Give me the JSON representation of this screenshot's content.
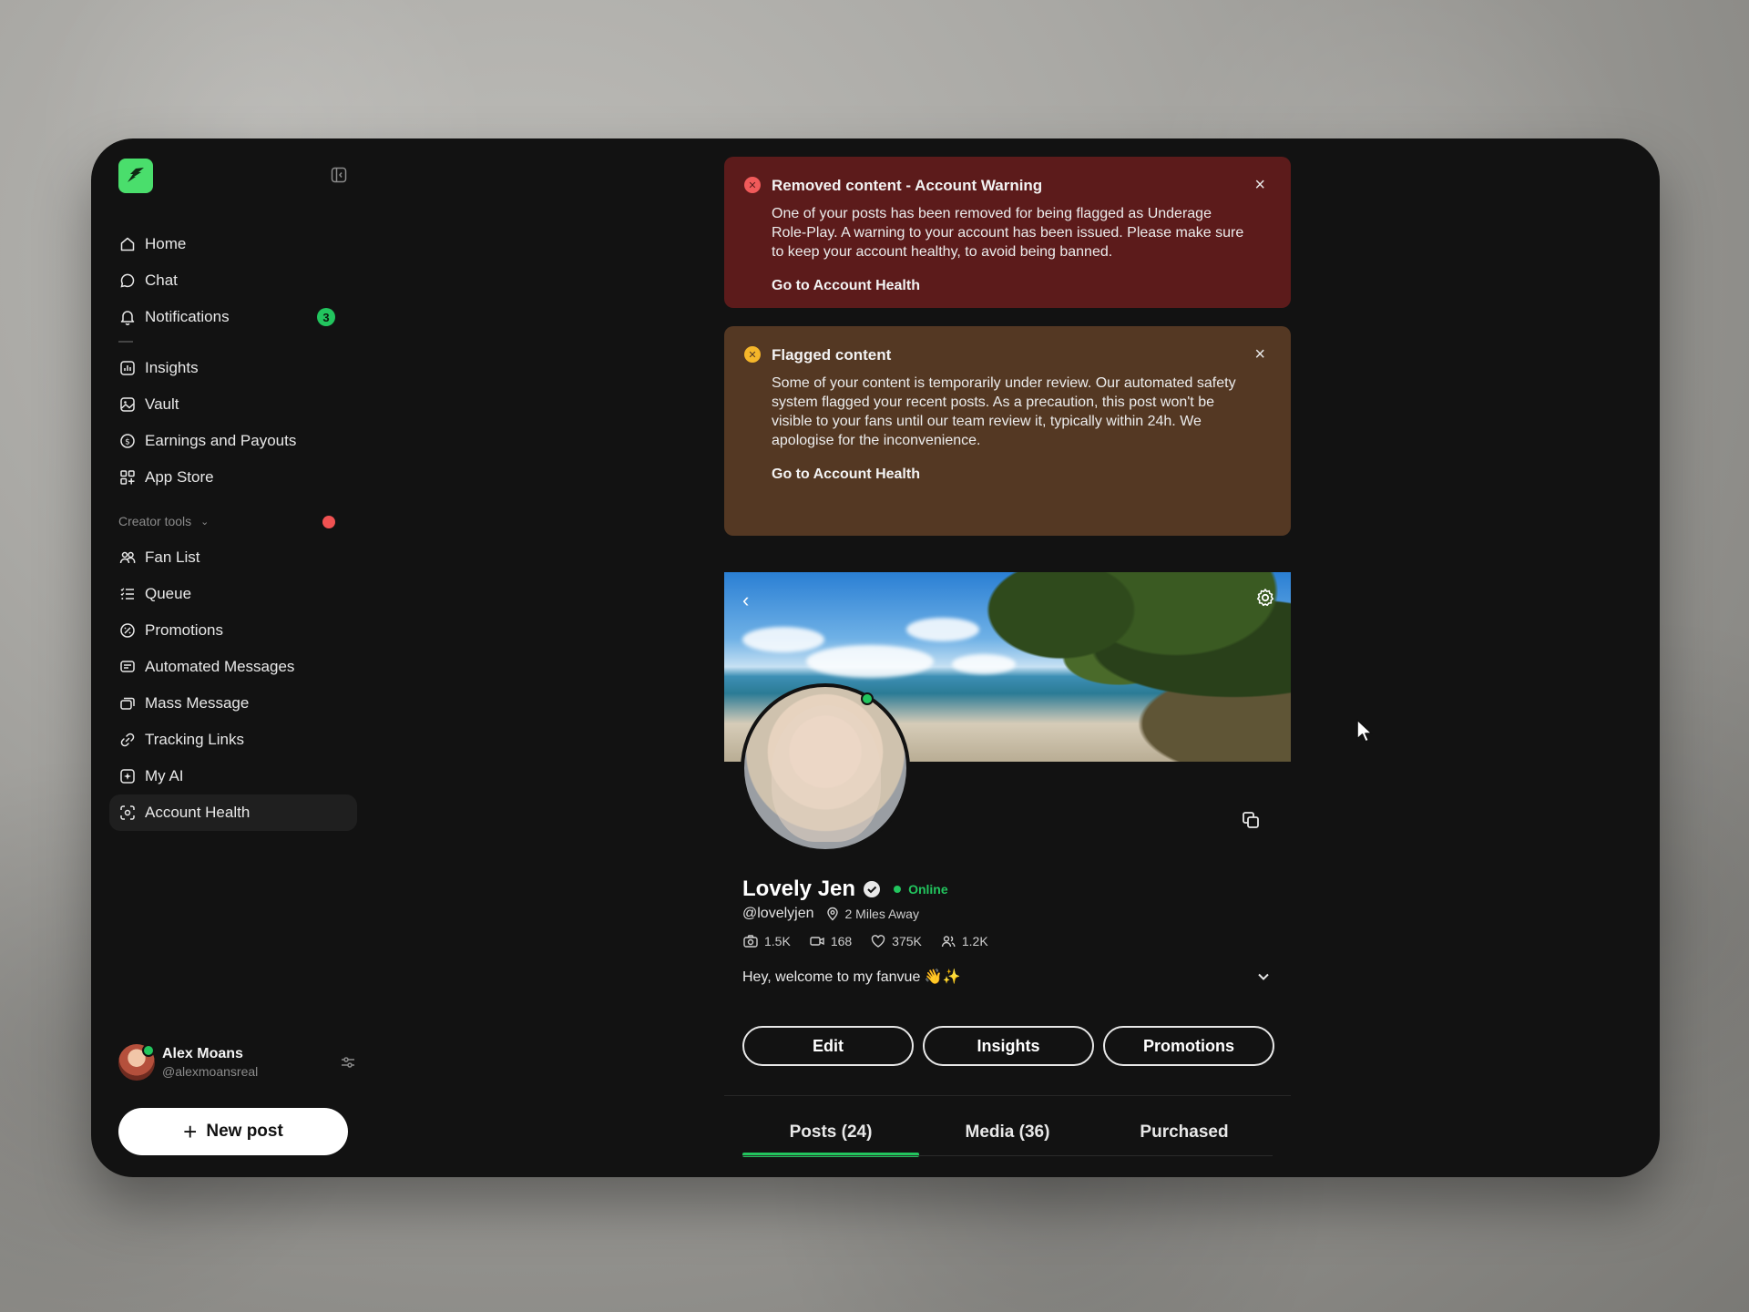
{
  "sidebar": {
    "primary": [
      {
        "label": "Home"
      },
      {
        "label": "Chat"
      },
      {
        "label": "Notifications",
        "badge": "3"
      }
    ],
    "secondary": [
      {
        "label": "Insights"
      },
      {
        "label": "Vault"
      },
      {
        "label": "Earnings and Payouts"
      },
      {
        "label": "App Store"
      }
    ],
    "creator_tools_label": "Creator tools",
    "creator_tools": [
      {
        "label": "Fan List"
      },
      {
        "label": "Queue"
      },
      {
        "label": "Promotions"
      },
      {
        "label": "Automated Messages"
      },
      {
        "label": "Mass Message"
      },
      {
        "label": "Tracking Links"
      },
      {
        "label": "My AI"
      },
      {
        "label": "Account Health",
        "active": true
      }
    ],
    "user": {
      "name": "Alex Moans",
      "handle": "@alexmoansreal"
    },
    "new_post_label": "New post"
  },
  "alerts": [
    {
      "title": "Removed content - Account Warning",
      "body": "One of your posts has been removed for being flagged as Underage Role-Play. A warning to your account has been issued. Please make sure to keep your account healthy, to avoid being banned.",
      "link": "Go to Account Health",
      "severity": "error",
      "color": "#5c1b1b"
    },
    {
      "title": "Flagged content",
      "body": "Some of your content is temporarily under review. Our automated safety system flagged your recent posts. As a precaution, this post won't be visible to your fans until our team review it, typically within 24h. We apologise for the inconvenience.",
      "link": "Go to Account Health",
      "severity": "warning",
      "color": "#543823"
    }
  ],
  "profile": {
    "name": "Lovely Jen",
    "status": "Online",
    "handle": "@lovelyjen",
    "location": "2 Miles Away",
    "stats": {
      "photos": "1.5K",
      "videos": "168",
      "likes": "375K",
      "fans": "1.2K"
    },
    "bio": "Hey, welcome to my fanvue 👋✨",
    "buttons": {
      "edit": "Edit",
      "insights": "Insights",
      "promotions": "Promotions"
    },
    "tabs": [
      {
        "label": "Posts (24)",
        "active": true
      },
      {
        "label": "Media (36)"
      },
      {
        "label": "Purchased"
      }
    ]
  },
  "colors": {
    "accent": "#22c55e",
    "background": "#121212"
  }
}
